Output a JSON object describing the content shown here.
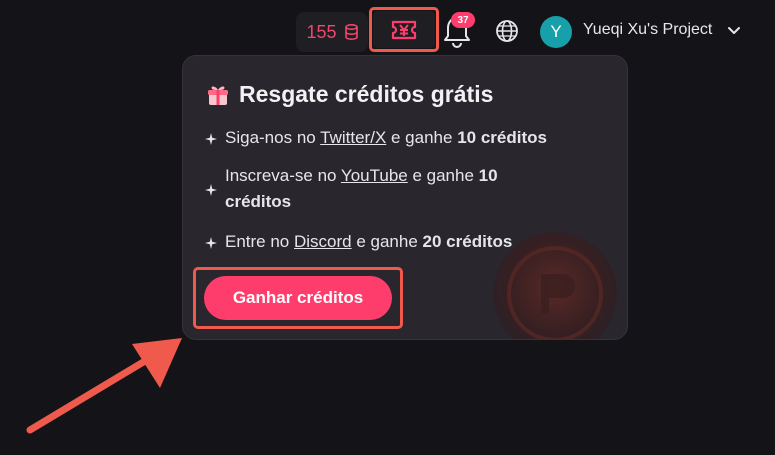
{
  "topbar": {
    "credits_count": "155",
    "notification_count": "37",
    "avatar_letter": "Y",
    "project_name": "Yueqi Xu's Project",
    "icons": [
      "coin-stack-icon",
      "ticket-icon",
      "bell-icon",
      "globe-icon",
      "chevron-down-icon"
    ]
  },
  "popover": {
    "title": "Resgate créditos grátis",
    "offers": [
      {
        "before": "Siga-nos no ",
        "link": "Twitter/X",
        "middle": " e ganhe ",
        "reward": "10 créditos"
      },
      {
        "before": "Inscreva-se no ",
        "link": "YouTube",
        "middle": " e ganhe ",
        "reward": "10 créditos"
      },
      {
        "before": "Entre no ",
        "link": "Discord",
        "middle": " e ganhe ",
        "reward": "20 créditos"
      }
    ],
    "cta_label": "Ganhar créditos"
  },
  "colors": {
    "accent": "#ff3d6c",
    "highlight_box": "#ef5a4d",
    "background": "#141418",
    "popover_bg": "#29272d",
    "avatar": "#17a0a9"
  }
}
